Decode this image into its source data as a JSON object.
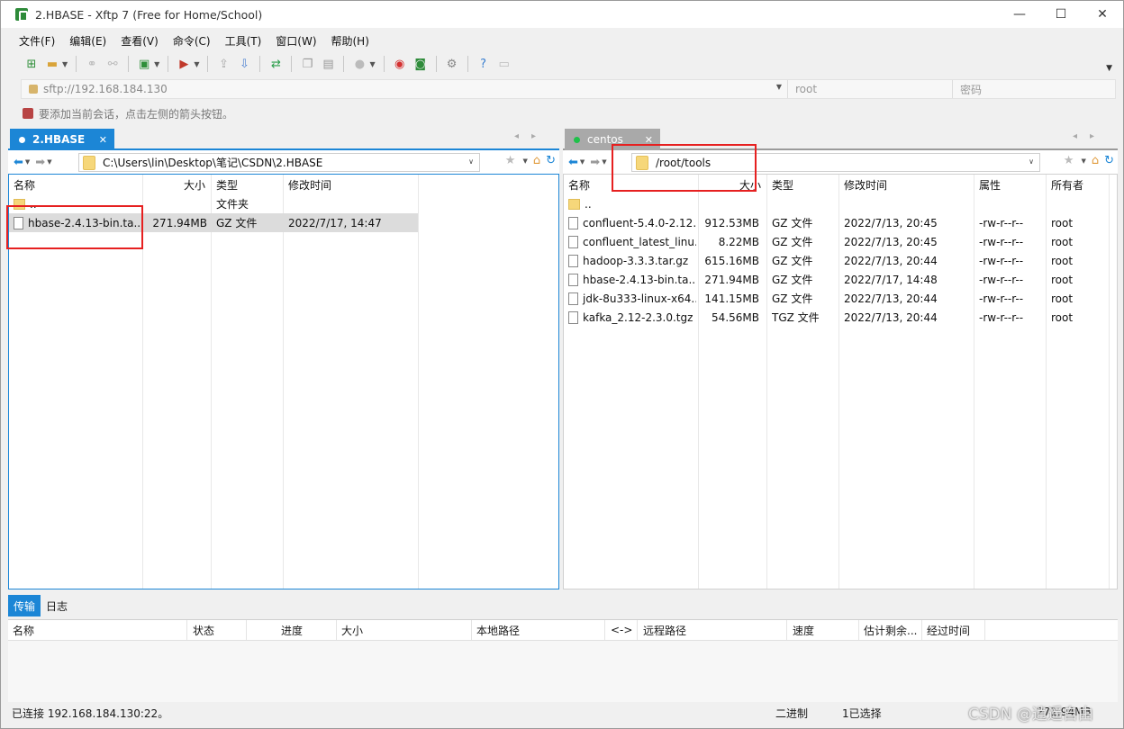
{
  "window": {
    "title": "2.HBASE - Xftp 7 (Free for Home/School)",
    "minimize": "—",
    "maximize": "☐",
    "close": "✕"
  },
  "menu": [
    "文件(F)",
    "编辑(E)",
    "查看(V)",
    "命令(C)",
    "工具(T)",
    "窗口(W)",
    "帮助(H)"
  ],
  "address": {
    "host": "sftp://192.168.184.130",
    "user_placeholder": "root",
    "password_placeholder": "密码"
  },
  "hint": "要添加当前会话，点击左侧的箭头按钮。",
  "left": {
    "tab_label": "2.HBASE",
    "path": "C:\\Users\\lin\\Desktop\\笔记\\CSDN\\2.HBASE",
    "columns": [
      "名称",
      "大小",
      "类型",
      "修改时间"
    ],
    "rows": [
      {
        "name": "..",
        "size": "",
        "type": "文件夹",
        "modified": "",
        "kind": "folder"
      },
      {
        "name": "hbase-2.4.13-bin.ta...",
        "size": "271.94MB",
        "type": "GZ 文件",
        "modified": "2022/7/17, 14:47",
        "kind": "file"
      }
    ]
  },
  "right": {
    "tab_label": "centos",
    "path": "/root/tools",
    "columns": [
      "名称",
      "大小",
      "类型",
      "修改时间",
      "属性",
      "所有者"
    ],
    "rows": [
      {
        "name": "..",
        "size": "",
        "type": "",
        "modified": "",
        "attr": "",
        "owner": "",
        "kind": "folder"
      },
      {
        "name": "confluent-5.4.0-2.12...",
        "size": "912.53MB",
        "type": "GZ 文件",
        "modified": "2022/7/13, 20:45",
        "attr": "-rw-r--r--",
        "owner": "root",
        "kind": "file"
      },
      {
        "name": "confluent_latest_linu...",
        "size": "8.22MB",
        "type": "GZ 文件",
        "modified": "2022/7/13, 20:45",
        "attr": "-rw-r--r--",
        "owner": "root",
        "kind": "file"
      },
      {
        "name": "hadoop-3.3.3.tar.gz",
        "size": "615.16MB",
        "type": "GZ 文件",
        "modified": "2022/7/13, 20:44",
        "attr": "-rw-r--r--",
        "owner": "root",
        "kind": "file"
      },
      {
        "name": "hbase-2.4.13-bin.ta...",
        "size": "271.94MB",
        "type": "GZ 文件",
        "modified": "2022/7/17, 14:48",
        "attr": "-rw-r--r--",
        "owner": "root",
        "kind": "file"
      },
      {
        "name": "jdk-8u333-linux-x64...",
        "size": "141.15MB",
        "type": "GZ 文件",
        "modified": "2022/7/13, 20:44",
        "attr": "-rw-r--r--",
        "owner": "root",
        "kind": "file"
      },
      {
        "name": "kafka_2.12-2.3.0.tgz",
        "size": "54.56MB",
        "type": "TGZ 文件",
        "modified": "2022/7/13, 20:44",
        "attr": "-rw-r--r--",
        "owner": "root",
        "kind": "file"
      }
    ]
  },
  "transfer": {
    "tabs": [
      "传输",
      "日志"
    ],
    "columns": [
      "名称",
      "状态",
      "进度",
      "大小",
      "本地路径",
      "<->",
      "远程路径",
      "速度",
      "估计剩余...",
      "经过时间"
    ]
  },
  "status": {
    "connected": "已连接 192.168.184.130:22。",
    "mode": "二进制",
    "selection": "1已选择",
    "size": "271.94MB"
  },
  "watermark": "CSDN @逍遥自由",
  "colors": {
    "accent": "#1c86d6",
    "highlight_box": "#e62020"
  }
}
